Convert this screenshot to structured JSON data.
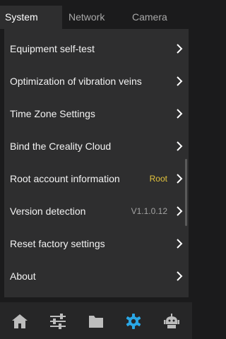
{
  "tabs": [
    {
      "label": "System",
      "active": true
    },
    {
      "label": "Network",
      "active": false
    },
    {
      "label": "Camera",
      "active": false
    }
  ],
  "menu": [
    {
      "label": "Equipment self-test",
      "value": ""
    },
    {
      "label": "Optimization of vibration veins",
      "value": ""
    },
    {
      "label": "Time Zone Settings",
      "value": ""
    },
    {
      "label": "Bind the Creality Cloud",
      "value": ""
    },
    {
      "label": "Root account information",
      "value": "Root"
    },
    {
      "label": "Version detection",
      "value": "V1.1.0.12"
    },
    {
      "label": "Reset factory settings",
      "value": ""
    },
    {
      "label": "About",
      "value": ""
    }
  ],
  "bottom_nav": [
    {
      "icon": "home-icon",
      "active": false
    },
    {
      "icon": "sliders-icon",
      "active": false
    },
    {
      "icon": "folder-icon",
      "active": false
    },
    {
      "icon": "gear-icon",
      "active": true
    },
    {
      "icon": "robot-icon",
      "active": false
    }
  ],
  "colors": {
    "background": "#1b1b1c",
    "panel": "#2e2e2f",
    "accent": "#2aa7e6",
    "root_value": "#e2c33d"
  }
}
